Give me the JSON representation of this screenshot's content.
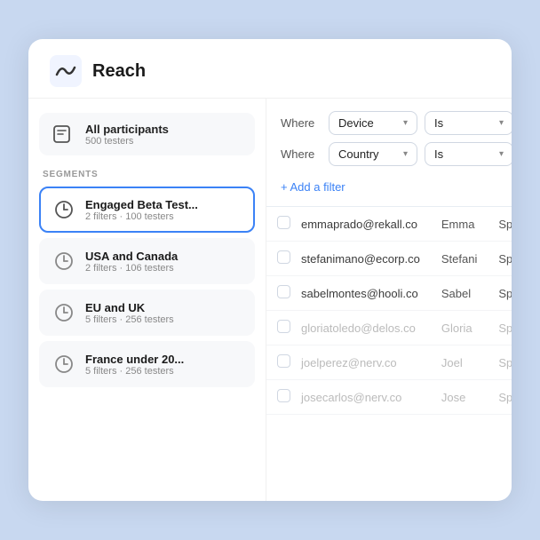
{
  "header": {
    "title": "Reach",
    "logo_alt": "reach-logo"
  },
  "sidebar": {
    "all_participants": {
      "label": "All participants",
      "count": "500 testers"
    },
    "segments_label": "SEGMENTS",
    "segments": [
      {
        "id": "engaged-beta",
        "name": "Engaged Beta Test...",
        "meta": "2 filters · 100 testers",
        "active": true
      },
      {
        "id": "usa-canada",
        "name": "USA and Canada",
        "meta": "2 filters · 106 testers",
        "active": false
      },
      {
        "id": "eu-uk",
        "name": "EU and UK",
        "meta": "5 filters · 256 testers",
        "active": false
      },
      {
        "id": "france-under",
        "name": "France under 20...",
        "meta": "5 filters · 256 testers",
        "active": false
      }
    ]
  },
  "filters": {
    "rows": [
      {
        "label": "Where",
        "field": "Device",
        "operator": "Is"
      },
      {
        "label": "Where",
        "field": "Country",
        "operator": "Is"
      }
    ],
    "add_filter_label": "+ Add a filter"
  },
  "table": {
    "rows": [
      {
        "email": "emmaprado@rekall.co",
        "first_name": "Emma",
        "country": "Spain",
        "muted": false
      },
      {
        "email": "stefanimano@ecorp.co",
        "first_name": "Stefani",
        "country": "Spain",
        "muted": false
      },
      {
        "email": "sabelmontes@hooli.co",
        "first_name": "Sabel",
        "country": "Spain",
        "muted": false
      },
      {
        "email": "gloriatoledo@delos.co",
        "first_name": "Gloria",
        "country": "Spain",
        "muted": true
      },
      {
        "email": "joelperez@nerv.co",
        "first_name": "Joel",
        "country": "Spain",
        "muted": true
      },
      {
        "email": "josecarlos@nerv.co",
        "first_name": "Jose",
        "country": "Spain",
        "muted": true
      }
    ]
  }
}
